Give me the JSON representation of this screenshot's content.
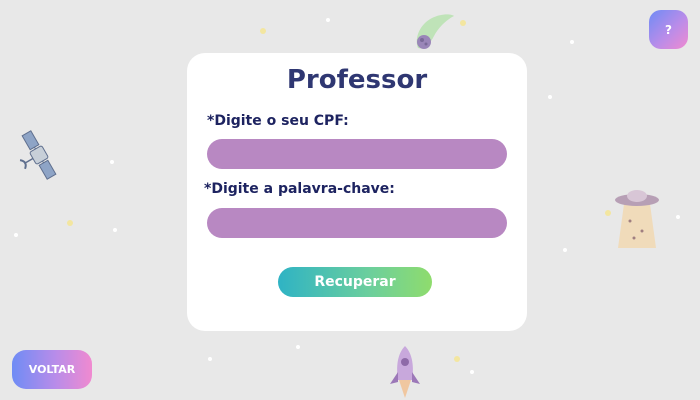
{
  "card": {
    "title": "Professor",
    "cpf_label": "*Digite o seu CPF:",
    "cpf_value": "",
    "keyword_label": "*Digite a palavra-chave:",
    "keyword_value": "",
    "recover_button": "Recuperar"
  },
  "help_button": "?",
  "back_button": "VOLTAR",
  "decorations": [
    "comet-icon",
    "satellite-icon",
    "ufo-icon",
    "rocket-icon"
  ]
}
